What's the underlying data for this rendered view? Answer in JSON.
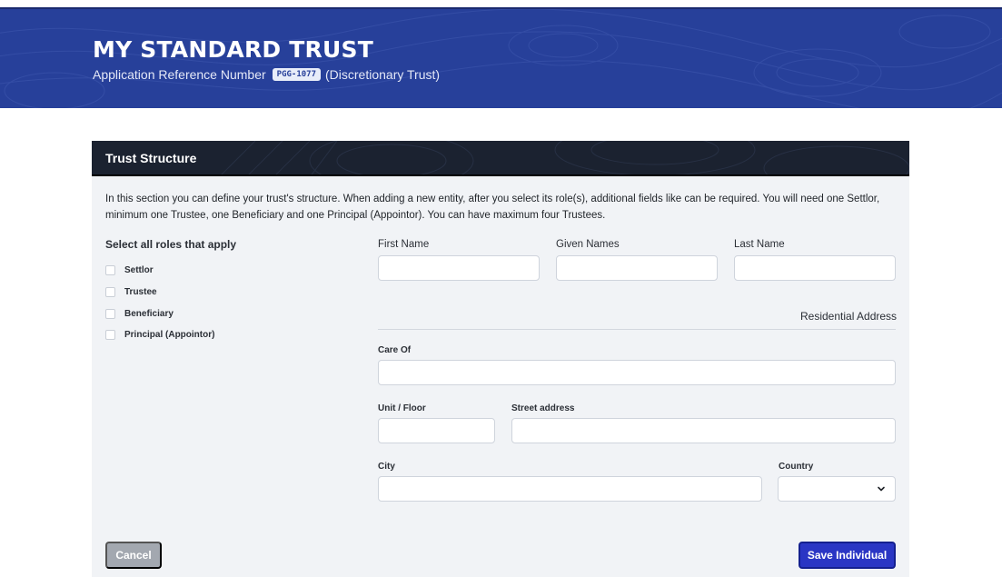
{
  "header": {
    "title": "MY STANDARD TRUST",
    "ref_prefix": "Application Reference Number",
    "ref_number": "PGG-1077",
    "trust_type": "(Discretionary Trust)"
  },
  "section": {
    "title": "Trust Structure",
    "intro": "In this section you can define your trust's structure. When adding a new entity, after you select its role(s), additional fields like can be required. You will need one Settlor, minimum one Trustee, one Beneficiary and one Principal (Appointor). You can have maximum four Trustees."
  },
  "roles": {
    "title": "Select all roles that apply",
    "items": [
      {
        "label": "Settlor",
        "checked": false
      },
      {
        "label": "Trustee",
        "checked": false
      },
      {
        "label": "Beneficiary",
        "checked": false
      },
      {
        "label": "Principal (Appointor)",
        "checked": false
      }
    ]
  },
  "name_fields": {
    "first_name": {
      "label": "First Name",
      "value": ""
    },
    "given_names": {
      "label": "Given Names",
      "value": ""
    },
    "last_name": {
      "label": "Last Name",
      "value": ""
    }
  },
  "address": {
    "title": "Residential Address",
    "care_of": {
      "label": "Care Of",
      "value": ""
    },
    "unit_floor": {
      "label": "Unit / Floor",
      "value": ""
    },
    "street": {
      "label": "Street address",
      "value": ""
    },
    "city": {
      "label": "City",
      "value": ""
    },
    "country": {
      "label": "Country",
      "value": ""
    }
  },
  "actions": {
    "cancel": "Cancel",
    "save": "Save Individual"
  },
  "colors": {
    "banner": "#27409a",
    "card_header": "#1b2230",
    "save_button": "#2a36c4",
    "cancel_button": "#a3a8b0"
  }
}
